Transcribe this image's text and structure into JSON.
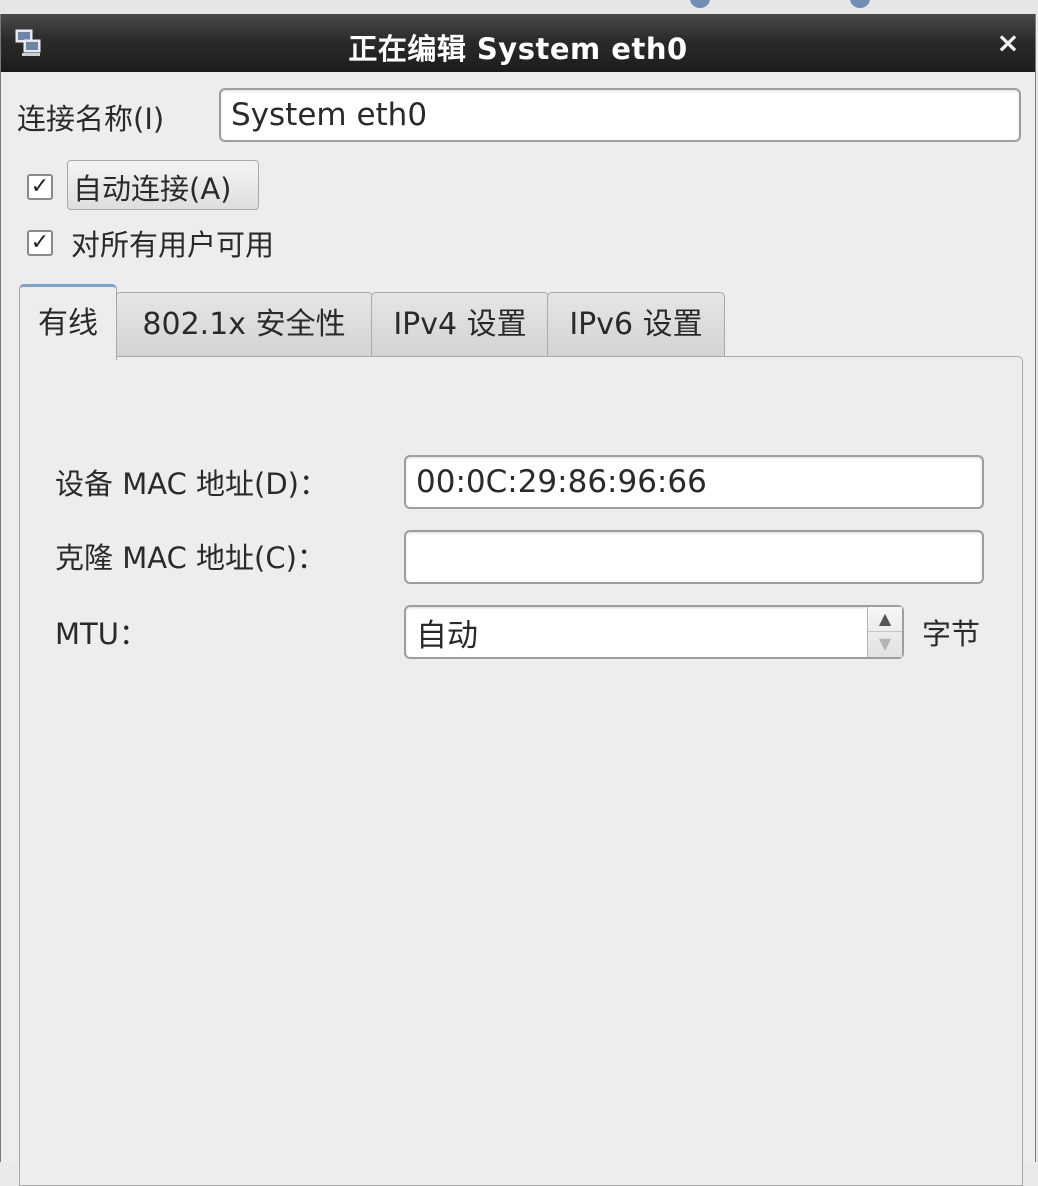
{
  "window": {
    "title": "正在编辑 System eth0",
    "close_glyph": "×"
  },
  "connection": {
    "name_label": "连接名称(I)",
    "name_value": "System eth0"
  },
  "options": {
    "auto_connect_label": "自动连接(A)",
    "auto_connect_checked": true,
    "all_users_label": "对所有用户可用",
    "all_users_checked": true,
    "check_glyph": "✓"
  },
  "tabs": [
    {
      "label": "有线",
      "active": true
    },
    {
      "label": "802.1x 安全性",
      "active": false
    },
    {
      "label": "IPv4 设置",
      "active": false
    },
    {
      "label": "IPv6 设置",
      "active": false
    }
  ],
  "wired": {
    "device_mac_label": "设备 MAC 地址(D)：",
    "device_mac_value": "00:0C:29:86:96:66",
    "cloned_mac_label": "克隆 MAC 地址(C)：",
    "cloned_mac_value": "",
    "mtu_label": "MTU：",
    "mtu_value": "自动",
    "mtu_unit": "字节"
  },
  "icons": {
    "window_icon": "network-computer-icon",
    "spin_up": "▲",
    "spin_down": "▼"
  }
}
